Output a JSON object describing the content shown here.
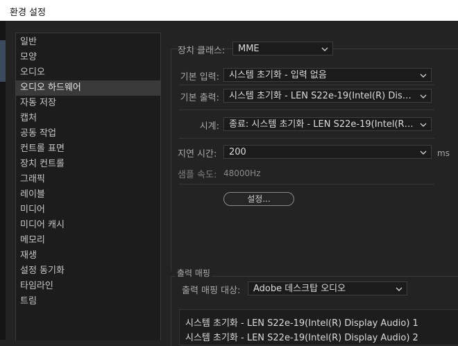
{
  "window": {
    "title": "환경 설정"
  },
  "sidebar": {
    "items": [
      {
        "label": "일반"
      },
      {
        "label": "모양"
      },
      {
        "label": "오디오"
      },
      {
        "label": "오디오 하드웨어",
        "selected": true
      },
      {
        "label": "자동 저장"
      },
      {
        "label": "캡처"
      },
      {
        "label": "공동 작업"
      },
      {
        "label": "컨트롤 표면"
      },
      {
        "label": "장치 컨트롤"
      },
      {
        "label": "그래픽"
      },
      {
        "label": "레이블"
      },
      {
        "label": "미디어"
      },
      {
        "label": "미디어 캐시"
      },
      {
        "label": "메모리"
      },
      {
        "label": "재생"
      },
      {
        "label": "설정 동기화"
      },
      {
        "label": "타임라인"
      },
      {
        "label": "트림"
      }
    ]
  },
  "hardware": {
    "device_class": {
      "label": "장치 클래스:",
      "value": "MME"
    },
    "default_input": {
      "label": "기본 입력:",
      "value": "시스템 초기화 - 입력 없음"
    },
    "default_output": {
      "label": "기본 출력:",
      "value": "시스템 초기화 - LEN S22e-19(Intel(R) Display ..."
    },
    "clock": {
      "label": "시계:",
      "value": "종료: 시스템 초기화 - LEN S22e-19(Intel(R) Di..."
    },
    "latency": {
      "label": "지연 시간:",
      "value": "200",
      "unit": "ms"
    },
    "sample_rate": {
      "label": "샘플 속도:",
      "value": "48000Hz"
    },
    "settings_button": "설정..."
  },
  "output_mapping": {
    "title": "출력 매핑",
    "target_label": "출력 매핑 대상:",
    "target_value": "Adobe 데스크탑 오디오",
    "channels": [
      "시스템 초기화 - LEN S22e-19(Intel(R) Display Audio) 1",
      "시스템 초기화 - LEN S22e-19(Intel(R) Display Audio) 2"
    ]
  }
}
